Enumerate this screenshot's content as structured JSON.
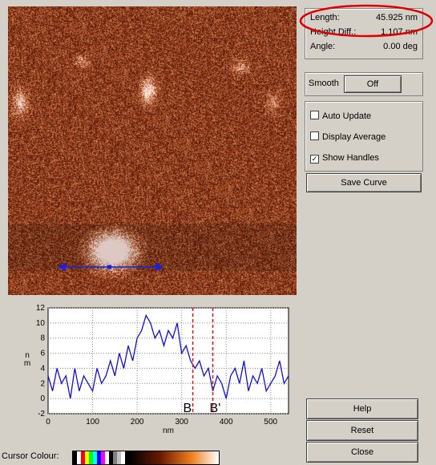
{
  "measurements": {
    "length_label": "Length:",
    "length_value": "45.925 nm",
    "height_label": "Height Diff.:",
    "height_value": "1.107 nm",
    "angle_label": "Angle:",
    "angle_value": "0.00 deg"
  },
  "smooth": {
    "label": "Smooth",
    "button": "Off"
  },
  "options": {
    "auto_update": {
      "label": "Auto Update",
      "checked": false
    },
    "display_average": {
      "label": "Display Average",
      "checked": false
    },
    "show_handles": {
      "label": "Show Handles",
      "checked": true,
      "mark": "✓"
    }
  },
  "buttons": {
    "save_curve": "Save Curve",
    "help": "Help",
    "reset": "Reset",
    "close": "Close"
  },
  "cursor_colour_label": "Cursor Colour:",
  "colors": {
    "highlight_ellipse": "#e00000",
    "profile_line": "#1010d0",
    "marker_line": "#e01010",
    "afm_base": "#7a2a10"
  },
  "chart_data": {
    "type": "line",
    "ylabel": "n\nm",
    "xlabel": "nm",
    "xlim": [
      0,
      540
    ],
    "ylim": [
      -2,
      12
    ],
    "xticks": [
      0,
      100,
      200,
      300,
      400,
      500
    ],
    "yticks": [
      -2,
      0,
      2,
      4,
      6,
      8,
      10,
      12
    ],
    "markers": [
      {
        "label": "B",
        "x": 325
      },
      {
        "label": "B'",
        "x": 370
      }
    ],
    "series": [
      {
        "x": [
          0,
          10,
          20,
          30,
          40,
          50,
          60,
          70,
          80,
          90,
          100,
          110,
          120,
          130,
          140,
          150,
          160,
          170,
          180,
          190,
          200,
          210,
          220,
          230,
          240,
          250,
          260,
          270,
          280,
          290,
          300,
          310,
          320,
          330,
          340,
          350,
          360,
          370,
          380,
          390,
          400,
          410,
          420,
          430,
          440,
          450,
          460,
          470,
          480,
          490,
          500,
          510,
          520,
          530,
          540
        ],
        "values": [
          3,
          1,
          4,
          2,
          3,
          0,
          4,
          1,
          3,
          2,
          1,
          4,
          2,
          3,
          5,
          3,
          6,
          4,
          7,
          5,
          8,
          9,
          11,
          10,
          8,
          9,
          7,
          9,
          8,
          10,
          6,
          7,
          5,
          4,
          5,
          3,
          4,
          1,
          3,
          2,
          0,
          3,
          4,
          2,
          5,
          1,
          3,
          2,
          4,
          1,
          2,
          3,
          5,
          2,
          3
        ]
      }
    ]
  }
}
